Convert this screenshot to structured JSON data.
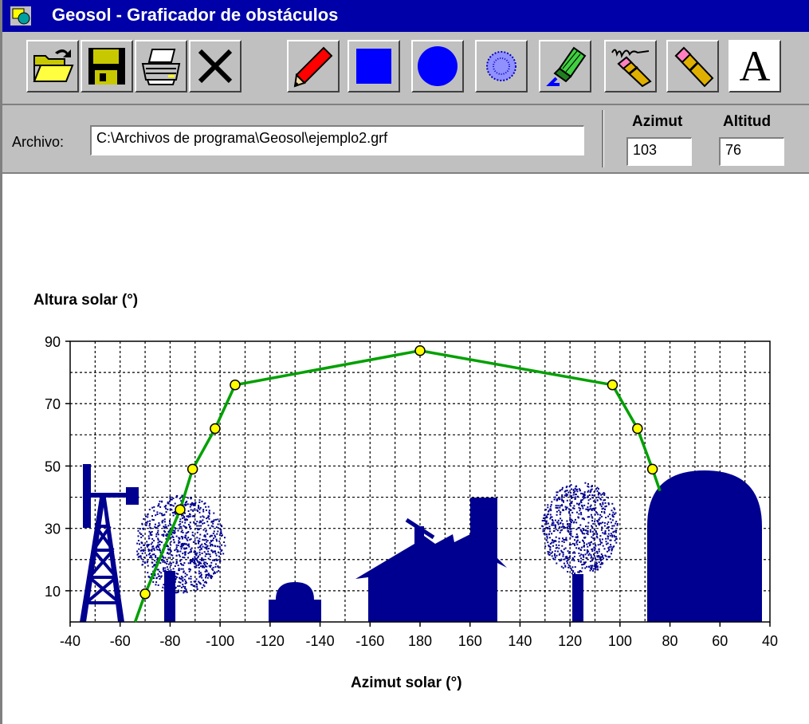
{
  "window": {
    "title": "Geosol - Graficador de obstáculos"
  },
  "toolbar": {
    "buttons": [
      {
        "name": "open-button",
        "icon": "open-folder-icon"
      },
      {
        "name": "save-button",
        "icon": "floppy-disk-icon"
      },
      {
        "name": "print-button",
        "icon": "printer-icon"
      },
      {
        "name": "delete-button",
        "icon": "x-cross-icon"
      },
      {
        "name": "pencil-button",
        "icon": "red-pencil-icon"
      },
      {
        "name": "square-button",
        "icon": "square-icon"
      },
      {
        "name": "circle-button",
        "icon": "circle-icon"
      },
      {
        "name": "tree-pattern-button",
        "icon": "dotted-circle-icon"
      },
      {
        "name": "fill-button",
        "icon": "paint-bucket-icon"
      },
      {
        "name": "eraser-line-button",
        "icon": "eraser-scribble-icon"
      },
      {
        "name": "eraser-button",
        "icon": "eraser-pencil-icon"
      },
      {
        "name": "text-button",
        "icon": "text-a-icon",
        "label": "A"
      }
    ]
  },
  "file": {
    "label": "Archivo:",
    "value": "C:\\Archivos de programa\\Geosol\\ejemplo2.grf"
  },
  "azimut": {
    "label": "Azimut",
    "value": "103"
  },
  "altitud": {
    "label": "Altitud",
    "value": "76"
  },
  "colors": {
    "obstacle": "#000090",
    "sunpath": "#00a000",
    "marker": "#ffff00",
    "grid": "#000000"
  },
  "chart_data": {
    "type": "line",
    "ylabel": "Altura solar (°)",
    "xlabel": "Azimut solar (°)",
    "x_tick_labels": [
      "-40",
      "-60",
      "-80",
      "-100",
      "-120",
      "-140",
      "-160",
      "180",
      "160",
      "140",
      "120",
      "100",
      "80",
      "60",
      "40"
    ],
    "y_tick_labels": [
      "90",
      "70",
      "50",
      "30",
      "10"
    ],
    "ylim": [
      0,
      90
    ],
    "grid": true,
    "series": [
      {
        "x": [
          -66,
          -70,
          -84,
          -89,
          -98,
          -106,
          180,
          103,
          93,
          87,
          84
        ],
        "y": [
          0,
          9,
          36,
          49,
          62,
          76,
          87,
          76,
          62,
          49,
          42
        ]
      }
    ]
  }
}
